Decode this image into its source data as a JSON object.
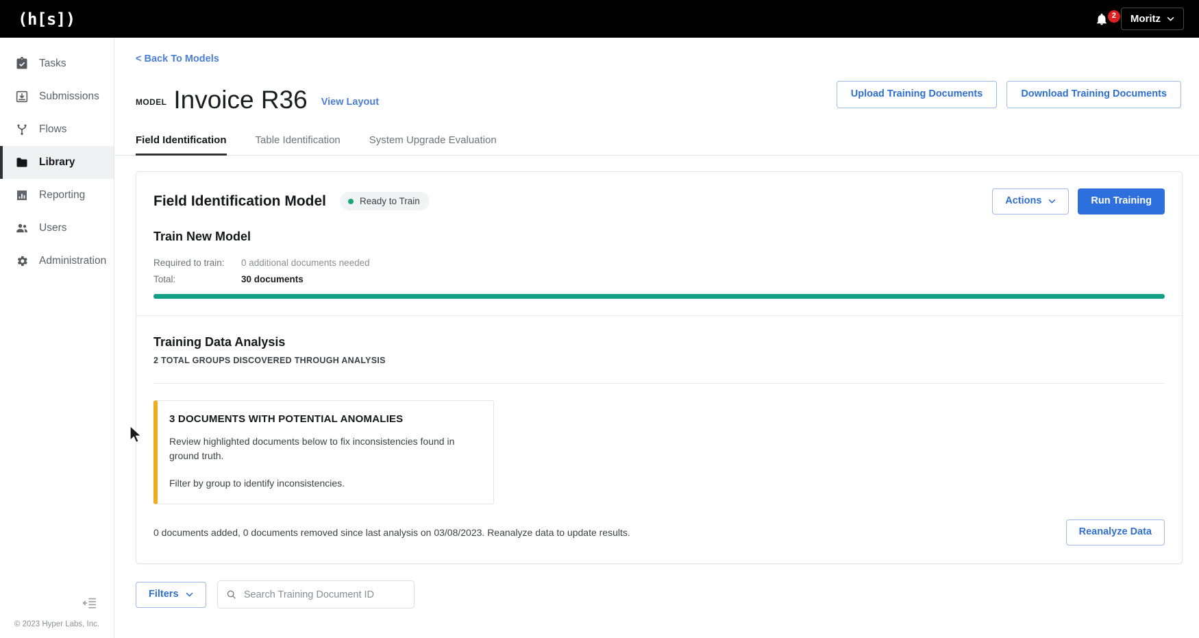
{
  "topbar": {
    "logo": "(h[s])",
    "notifications_icon": "bell-icon",
    "notifications_count": "2",
    "user_name": "Moritz"
  },
  "sidebar": {
    "items": [
      {
        "label": "Tasks",
        "icon": "clipboard-check-icon",
        "active": false
      },
      {
        "label": "Submissions",
        "icon": "inbox-download-icon",
        "active": false
      },
      {
        "label": "Flows",
        "icon": "flow-branch-icon",
        "active": false
      },
      {
        "label": "Library",
        "icon": "folder-icon",
        "active": true
      },
      {
        "label": "Reporting",
        "icon": "bar-chart-icon",
        "active": false
      },
      {
        "label": "Users",
        "icon": "users-icon",
        "active": false
      },
      {
        "label": "Administration",
        "icon": "gear-icon",
        "active": false
      }
    ],
    "collapse_icon": "collapse-sidebar-icon",
    "copyright": "© 2023 Hyper Labs, Inc."
  },
  "page": {
    "back_link": "< Back To Models",
    "kicker": "MODEL",
    "title": "Invoice R36",
    "view_layout": "View Layout",
    "upload_button": "Upload Training Documents",
    "download_button": "Download Training Documents"
  },
  "tabs": [
    {
      "label": "Field Identification",
      "active": true
    },
    {
      "label": "Table Identification",
      "active": false
    },
    {
      "label": "System Upgrade Evaluation",
      "active": false
    }
  ],
  "card": {
    "title": "Field Identification Model",
    "status": "Ready to Train",
    "status_color": "#19a974",
    "actions_button": "Actions",
    "run_training_button": "Run Training",
    "train": {
      "title": "Train New Model",
      "required_label": "Required to train:",
      "required_value": "0 additional documents needed",
      "total_label": "Total:",
      "total_value": "30 documents",
      "progress_percent": 100,
      "progress_color": "#14a085"
    },
    "analysis": {
      "title": "Training Data Analysis",
      "subtitle": "2 TOTAL GROUPS DISCOVERED THROUGH ANALYSIS",
      "callout": {
        "accent_color": "#f0ab21",
        "title": "3 DOCUMENTS WITH POTENTIAL ANOMALIES",
        "body": "Review highlighted documents below to fix inconsistencies found in ground truth.",
        "body2": "Filter by group to identify inconsistencies."
      },
      "footer_note": "0 documents added, 0 documents removed since last analysis on 03/08/2023. Reanalyze data to update results.",
      "reanalyze_button": "Reanalyze Data"
    }
  },
  "toolbar": {
    "filters_button": "Filters",
    "search_icon": "search-icon",
    "search_value": "",
    "search_placeholder": "Search Training Document ID"
  }
}
